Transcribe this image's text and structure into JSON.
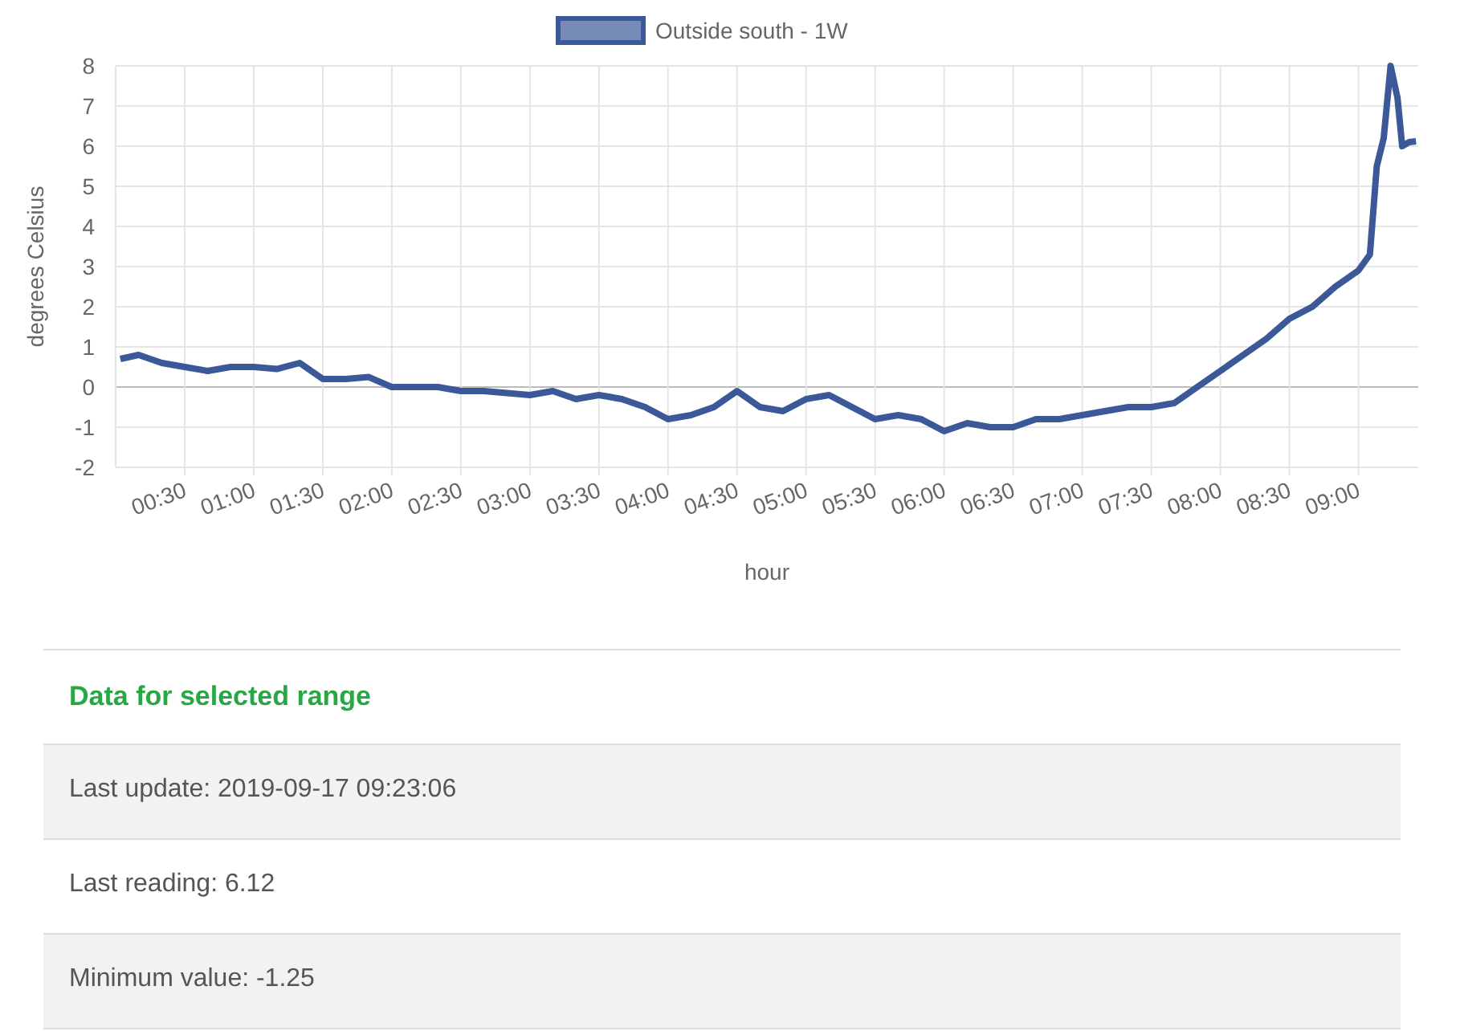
{
  "chart_data": {
    "type": "line",
    "grid": true,
    "ylabel": "degrees Celsius",
    "xlabel": "hour",
    "xlim": [
      0,
      566
    ],
    "ylim": [
      -2,
      8
    ],
    "yticks": [
      -2,
      -1,
      0,
      1,
      2,
      3,
      4,
      5,
      6,
      7,
      8
    ],
    "xticks": [
      {
        "value": 30,
        "label": "00:30"
      },
      {
        "value": 60,
        "label": "01:00"
      },
      {
        "value": 90,
        "label": "01:30"
      },
      {
        "value": 120,
        "label": "02:00"
      },
      {
        "value": 150,
        "label": "02:30"
      },
      {
        "value": 180,
        "label": "03:00"
      },
      {
        "value": 210,
        "label": "03:30"
      },
      {
        "value": 240,
        "label": "04:00"
      },
      {
        "value": 270,
        "label": "04:30"
      },
      {
        "value": 300,
        "label": "05:00"
      },
      {
        "value": 330,
        "label": "05:30"
      },
      {
        "value": 360,
        "label": "06:00"
      },
      {
        "value": 390,
        "label": "06:30"
      },
      {
        "value": 420,
        "label": "07:00"
      },
      {
        "value": 450,
        "label": "07:30"
      },
      {
        "value": 480,
        "label": "08:00"
      },
      {
        "value": 510,
        "label": "08:30"
      },
      {
        "value": 540,
        "label": "09:00"
      }
    ],
    "x": [
      2,
      10,
      20,
      30,
      40,
      50,
      60,
      70,
      80,
      90,
      100,
      110,
      120,
      130,
      140,
      150,
      160,
      170,
      180,
      190,
      200,
      210,
      220,
      230,
      240,
      250,
      260,
      270,
      280,
      290,
      300,
      310,
      320,
      330,
      340,
      350,
      360,
      370,
      380,
      390,
      400,
      410,
      420,
      430,
      440,
      450,
      460,
      470,
      480,
      490,
      500,
      510,
      520,
      530,
      540,
      545,
      548,
      551,
      554,
      557,
      559,
      562,
      565
    ],
    "series": [
      {
        "name": "Outside south - 1W",
        "color": "#3b5998",
        "values": [
          0.7,
          0.8,
          0.6,
          0.5,
          0.4,
          0.5,
          0.5,
          0.45,
          0.6,
          0.2,
          0.2,
          0.25,
          0.0,
          0.0,
          0.0,
          -0.1,
          -0.1,
          -0.15,
          -0.2,
          -0.1,
          -0.3,
          -0.2,
          -0.3,
          -0.5,
          -0.8,
          -0.7,
          -0.5,
          -0.1,
          -0.5,
          -0.6,
          -0.3,
          -0.2,
          -0.5,
          -0.8,
          -0.7,
          -0.8,
          -1.1,
          -0.9,
          -1.0,
          -1.0,
          -0.8,
          -0.8,
          -0.7,
          -0.6,
          -0.5,
          -0.5,
          -0.4,
          0.0,
          0.4,
          0.8,
          1.2,
          1.7,
          2.0,
          2.5,
          2.9,
          3.3,
          5.5,
          6.2,
          8.0,
          7.2,
          6.0,
          6.1,
          6.12
        ]
      }
    ]
  },
  "panel": {
    "title": "Data for selected range",
    "rows": [
      "Last update: 2019-09-17 09:23:06",
      "Last reading: 6.12",
      "Minimum value: -1.25"
    ]
  }
}
